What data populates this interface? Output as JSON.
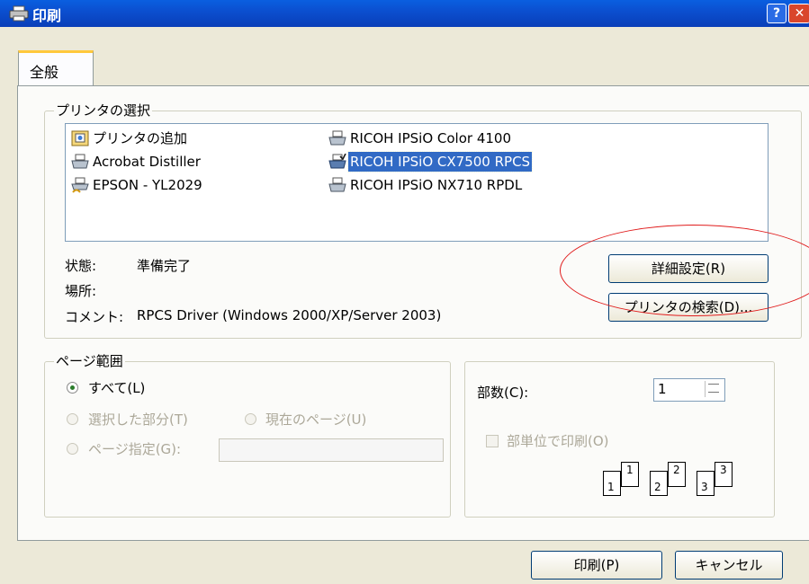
{
  "window": {
    "title": "印刷"
  },
  "tabs": [
    {
      "label": "全般"
    }
  ],
  "printer_section": {
    "legend": "プリンタの選択",
    "printers": [
      {
        "name": "プリンタの追加",
        "icon": "add-printer-icon"
      },
      {
        "name": "Acrobat Distiller",
        "icon": "printer-icon"
      },
      {
        "name": "EPSON - YL2029",
        "icon": "shared-printer-icon"
      },
      {
        "name": "RICOH IPSiO Color 4100",
        "icon": "printer-icon"
      },
      {
        "name": "RICOH IPSiO CX7500 RPCS",
        "icon": "default-printer-icon",
        "selected": true
      },
      {
        "name": "RICOH IPSiO NX710 RPDL",
        "icon": "printer-icon"
      }
    ],
    "status_label": "状態:",
    "status_value": "準備完了",
    "location_label": "場所:",
    "location_value": "",
    "comment_label": "コメント:",
    "comment_value": "RPCS Driver (Windows 2000/XP/Server 2003)",
    "details_button": "詳細設定(R)",
    "find_button": "プリンタの検索(D)..."
  },
  "page_range": {
    "legend": "ページ範囲",
    "all": "すべて(L)",
    "selection": "選択した部分(T)",
    "current": "現在のページ(U)",
    "pages": "ページ指定(G):",
    "pages_value": ""
  },
  "copies": {
    "label": "部数(C):",
    "value": "1",
    "collate_label": "部単位で印刷(O)",
    "collate_pages": [
      "1",
      "1",
      "2",
      "2",
      "3",
      "3"
    ]
  },
  "buttons": {
    "print": "印刷(P)",
    "cancel": "キャンセル"
  },
  "colors": {
    "annotation": "#e01b1b",
    "selection": "#316ac5",
    "titlebar": "#0b4fd0"
  }
}
